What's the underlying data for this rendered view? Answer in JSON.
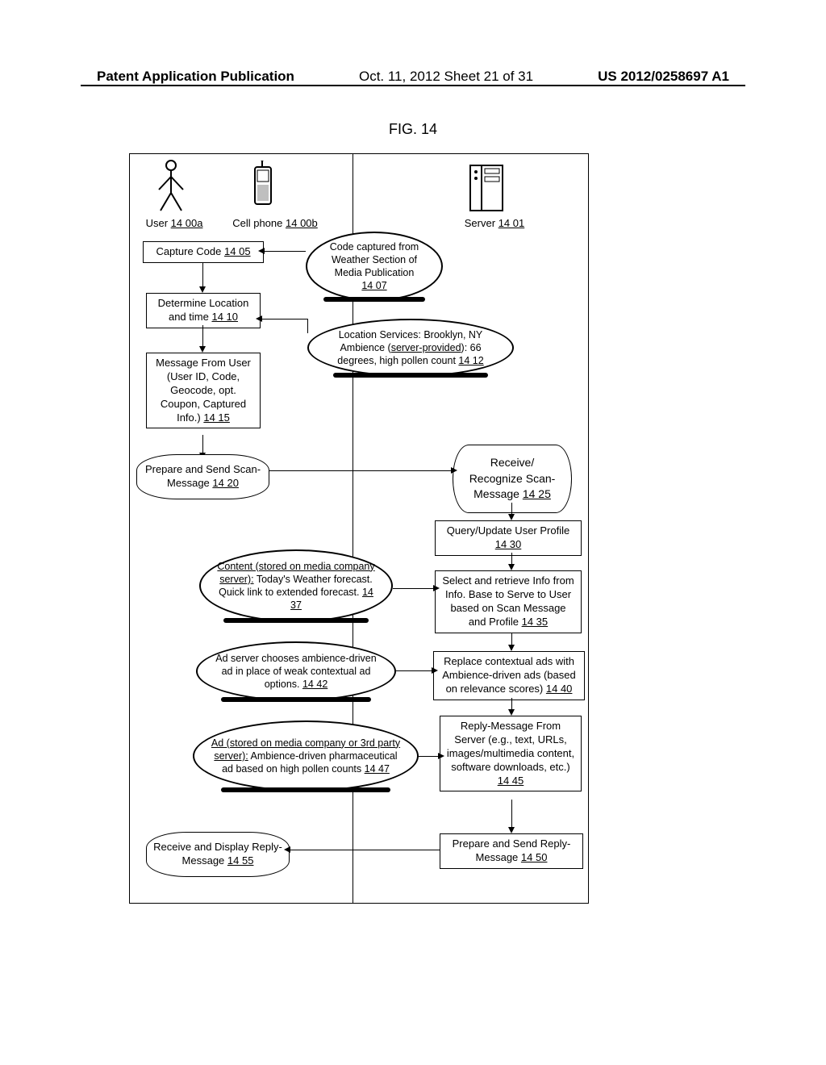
{
  "header": {
    "left": "Patent Application Publication",
    "center": "Oct. 11, 2012 Sheet 21 of 31",
    "right": "US 2012/0258697 A1"
  },
  "figure_title": "FIG. 14",
  "actors": {
    "user_label": "User",
    "user_ref": "14 00a",
    "phone_label": "Cell phone",
    "phone_ref": "14 00b",
    "server_label": "Server",
    "server_ref": "14 01"
  },
  "boxes": {
    "capture_code": "Capture Code",
    "capture_code_ref": "14 05",
    "determine_loc": "Determine Location and time",
    "determine_loc_ref": "14 10",
    "msg_from_user": "Message From User (User ID, Code, Geocode, opt. Coupon, Captured Info.)",
    "msg_from_user_ref": "14 15",
    "query_update": "Query/Update User Profile",
    "query_update_ref": "14 30",
    "select_retrieve": "Select and retrieve Info from Info. Base to Serve to User based on Scan Message and Profile",
    "select_retrieve_ref": "14 35",
    "replace_ads": "Replace contextual ads with Ambience-driven ads (based on relevance scores)",
    "replace_ads_ref": "14 40",
    "reply_msg": "Reply-Message From Server (e.g., text, URLs, images/multimedia content, software downloads, etc.)",
    "reply_msg_ref": "14 45",
    "prepare_send_reply": "Prepare and Send Reply-Message",
    "prepare_send_reply_ref": "14 50"
  },
  "clouds": {
    "code_captured": "Code captured from Weather Section of Media Publication",
    "code_captured_ref": "14 07",
    "location_services_pre": "Location Services: Brooklyn, NY Ambience (",
    "location_services_underlined": "server-provided",
    "location_services_post": "): 66 degrees, high pollen count",
    "location_services_ref": "14 12",
    "content_pre_underlined": "Content (stored on media company server):",
    "content_post": " Today's Weather forecast. Quick link to extended forecast.",
    "content_ref": "14 37",
    "ad_server": "Ad server chooses ambience-driven ad in place of weak contextual ad options.",
    "ad_server_ref": "14 42",
    "ad_stored_pre_underlined": "Ad (stored on media company or 3rd party server):",
    "ad_stored_post": " Ambience-driven pharmaceutical ad based on high pollen counts",
    "ad_stored_ref": "14 47"
  },
  "sends": {
    "prepare_scan": "Prepare and Send Scan-Message",
    "prepare_scan_ref": "14 20",
    "receive_display": "Receive and Display Reply-Message",
    "receive_display_ref": "14 55"
  },
  "recvs": {
    "receive_recognize": "Receive/ Recognize Scan-Message",
    "receive_recognize_ref": "14 25"
  }
}
